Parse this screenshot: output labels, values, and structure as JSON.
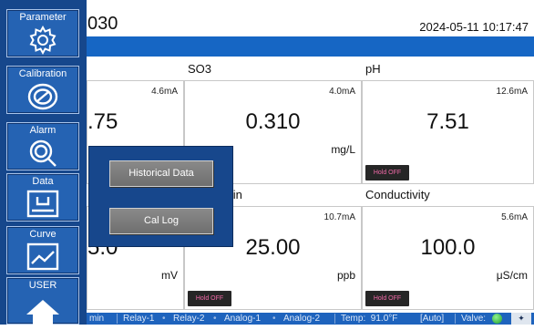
{
  "header": {
    "device_title": "030",
    "datetime": "2024-05-11 10:17:47"
  },
  "sidebar": {
    "items": [
      {
        "label": "Parameter",
        "icon": "gear-icon"
      },
      {
        "label": "Calibration",
        "icon": "calibration-dial-icon"
      },
      {
        "label": "Alarm",
        "icon": "alarm-search-icon"
      },
      {
        "label": "Data",
        "icon": "data-download-icon"
      },
      {
        "label": "Curve",
        "icon": "curve-chart-icon"
      },
      {
        "label": "USER",
        "icon": "home-icon"
      }
    ]
  },
  "tiles": [
    {
      "name": "",
      "ma": "4.6mA",
      "value": ".75",
      "unit": ""
    },
    {
      "name": "SO3",
      "ma": "4.0mA",
      "value": "0.310",
      "unit": "mg/L"
    },
    {
      "name": "pH",
      "ma": "12.6mA",
      "value": "7.51",
      "unit": "",
      "hold": "Hold OFF"
    },
    {
      "name": "",
      "ma": "",
      "value": "5.0",
      "unit": "mV"
    },
    {
      "name": "cein",
      "ma": "10.7mA",
      "value": "25.00",
      "unit": "ppb",
      "hold": "Hold OFF"
    },
    {
      "name": "Conductivity",
      "ma": "5.6mA",
      "value": "100.0",
      "unit": "μS/cm",
      "hold": "Hold OFF"
    }
  ],
  "popup": {
    "historical_label": "Historical Data",
    "cal_log_label": "Cal Log"
  },
  "status_bar": {
    "left": "min",
    "relay1": "Relay-1",
    "relay2": "Relay-2",
    "analog1": "Analog-1",
    "analog2": "Analog-2",
    "temp": "Temp:  91.0°F",
    "mode": "[Auto]",
    "valve": "Valve:",
    "valve_color": "#2aa83a"
  }
}
